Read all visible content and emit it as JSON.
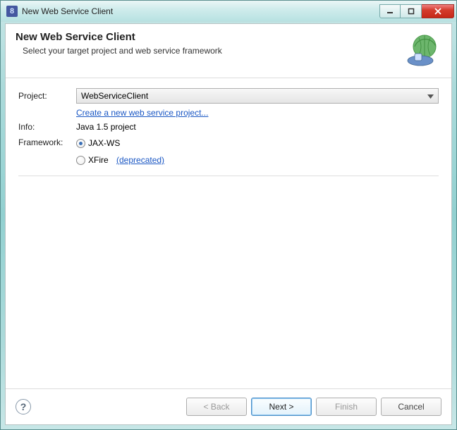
{
  "window": {
    "title": "New Web Service Client"
  },
  "header": {
    "title": "New Web Service Client",
    "subtitle": "Select your target project and web service framework"
  },
  "form": {
    "project_label": "Project:",
    "project_value": "WebServiceClient",
    "create_link": "Create a new web service project...",
    "info_label": "Info:",
    "info_value": "Java 1.5 project",
    "framework_label": "Framework:",
    "option_jaxws": "JAX-WS",
    "option_xfire": "XFire",
    "deprecated": "(deprecated)"
  },
  "buttons": {
    "back": "< Back",
    "next": "Next >",
    "finish": "Finish",
    "cancel": "Cancel"
  }
}
